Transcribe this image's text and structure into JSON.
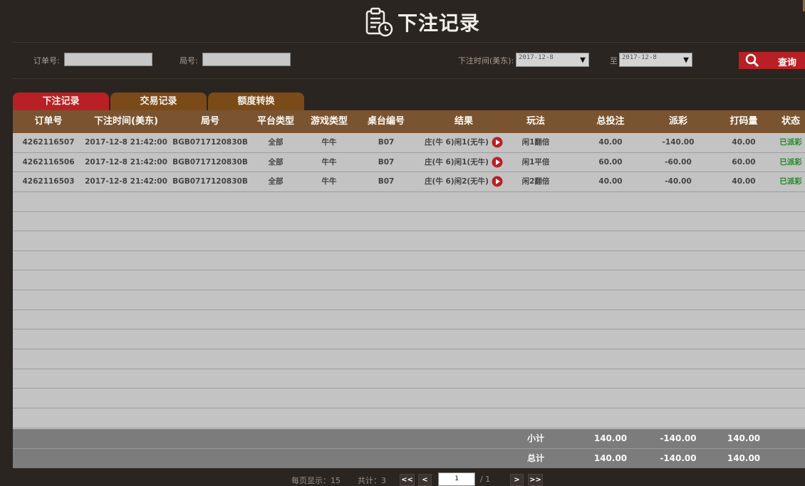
{
  "header": {
    "title": "下注记录",
    "icon": "clipboard-clock-icon"
  },
  "filters": {
    "order_label": "订单号:",
    "order_value": "",
    "round_label": "局号:",
    "round_value": "",
    "time_label": "下注时间(美东):",
    "date_from": "2017-12-8",
    "to_label": "至",
    "date_to": "2017-12-8",
    "search_label": "查询"
  },
  "tabs": [
    {
      "label": "下注记录",
      "active": true
    },
    {
      "label": "交易记录",
      "active": false
    },
    {
      "label": "额度转换",
      "active": false
    }
  ],
  "table": {
    "columns": [
      "订单号",
      "下注时间(美东)",
      "局号",
      "平台类型",
      "游戏类型",
      "桌台编号",
      "结果",
      "玩法",
      "总投注",
      "派彩",
      "打码量",
      "状态"
    ],
    "rows": [
      [
        "4262116507",
        "2017-12-8 21:42:00",
        "BGB0717120830B",
        "全部",
        "牛牛",
        "B07",
        "庄(牛 6)闲1(无牛)",
        "闲1翻倍",
        "40.00",
        "-140.00",
        "40.00",
        "已派彩"
      ],
      [
        "4262116506",
        "2017-12-8 21:42:00",
        "BGB0717120830B",
        "全部",
        "牛牛",
        "B07",
        "庄(牛 6)闲1(无牛)",
        "闲1平倍",
        "60.00",
        "-60.00",
        "60.00",
        "已派彩"
      ],
      [
        "4262116503",
        "2017-12-8 21:42:00",
        "BGB0717120830B",
        "全部",
        "牛牛",
        "B07",
        "庄(牛 6)闲2(无牛)",
        "闲2翻倍",
        "40.00",
        "-40.00",
        "40.00",
        "已派彩"
      ]
    ],
    "empty_rows": 12
  },
  "totals": {
    "subtotal": {
      "label": "小计",
      "bet": "140.00",
      "payout": "-140.00",
      "turnover": "140.00"
    },
    "total": {
      "label": "总计",
      "bet": "140.00",
      "payout": "-140.00",
      "turnover": "140.00"
    }
  },
  "pager": {
    "per_page": "每页显示：15",
    "count": "共计：3",
    "first": "<<",
    "prev": "<",
    "page": "1",
    "page_total": "/ 1",
    "next": ">",
    "last": ">>"
  },
  "colors": {
    "background": "#2a2521",
    "accent_red": "#b82025",
    "tab_brown": "#7a4b18",
    "header_brown": "#7a5430",
    "status_green": "#1e8a25"
  }
}
